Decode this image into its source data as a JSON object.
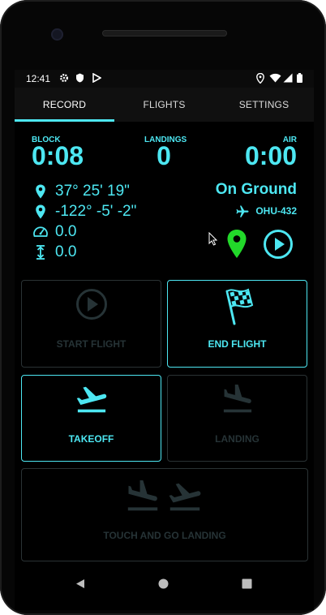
{
  "status_bar": {
    "time": "12:41"
  },
  "tabs": {
    "record": "RECORD",
    "flights": "FLIGHTS",
    "settings": "SETTINGS"
  },
  "stats": {
    "block_label": "BLOCK",
    "block_value": "0:08",
    "landings_label": "LANDINGS",
    "landings_value": "0",
    "air_label": "AIR",
    "air_value": "0:00"
  },
  "position": {
    "latitude": "37° 25' 19\"",
    "longitude": "-122° -5' -2\"",
    "speed": "0.0",
    "altitude": "0.0"
  },
  "flight_status": {
    "state": "On Ground",
    "aircraft": "OHU-432"
  },
  "buttons": {
    "start_flight": "START FLIGHT",
    "end_flight": "END FLIGHT",
    "takeoff": "TAKEOFF",
    "landing": "LANDING",
    "touch_and_go": "TOUCH AND GO LANDING"
  },
  "colors": {
    "accent": "#4de7f2",
    "location_active": "#22d82a",
    "disabled": "#263336"
  }
}
